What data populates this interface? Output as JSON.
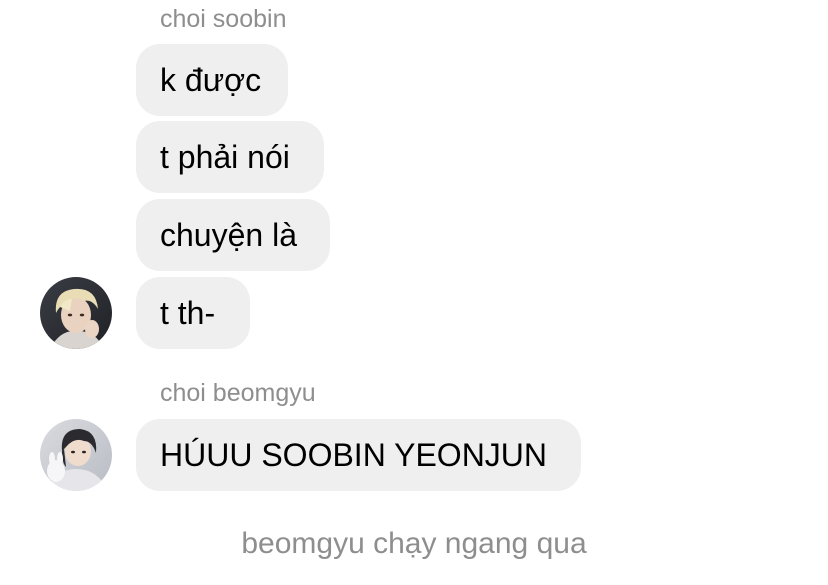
{
  "messages": {
    "group1": {
      "sender": "choi soobin",
      "bubbles": [
        "k được",
        "t phải nói",
        "chuyện là",
        "t th-"
      ],
      "avatar_icon": "profile-photo-blonde"
    },
    "group2": {
      "sender": "choi beomgyu",
      "bubbles": [
        "HÚUU SOOBIN YEONJUN"
      ],
      "avatar_icon": "profile-photo-dark-hair"
    }
  },
  "narration": "beomgyu chạy ngang qua",
  "colors": {
    "bubble_bg": "#efefef",
    "name_text": "#8e8e8e",
    "message_text": "#000000",
    "page_bg": "#ffffff"
  }
}
